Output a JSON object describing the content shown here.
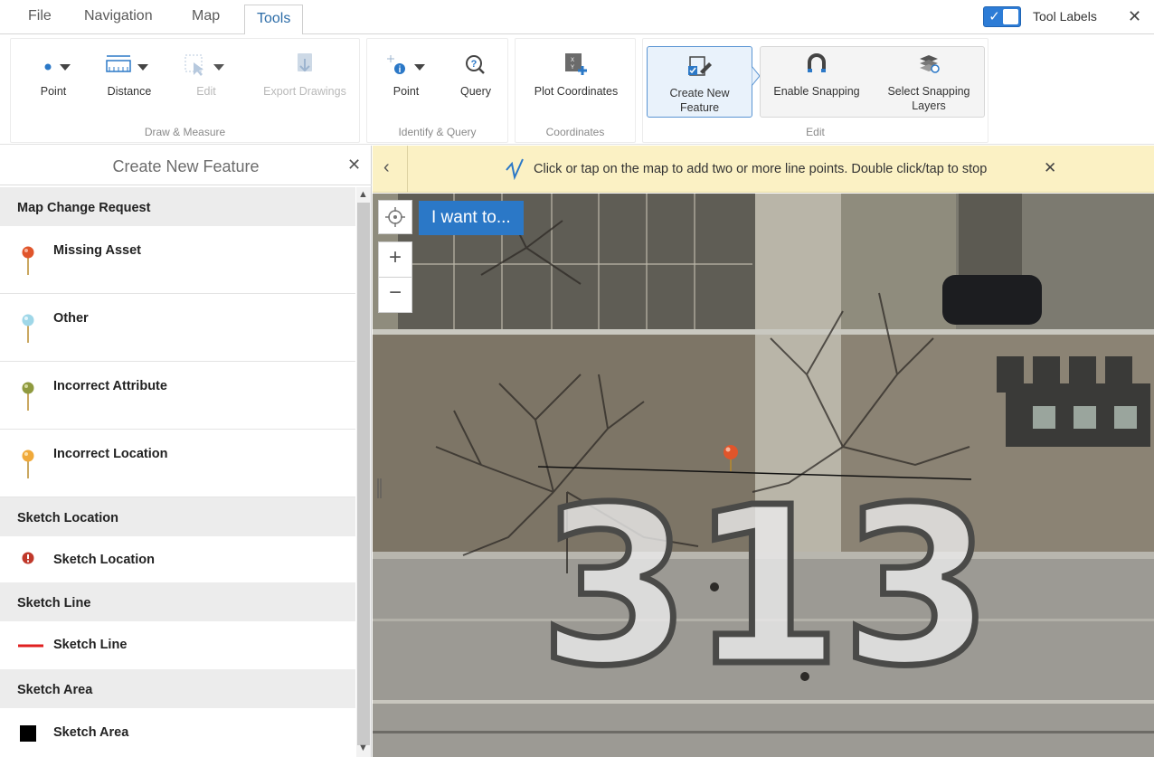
{
  "menu": {
    "tabs": [
      {
        "label": "File"
      },
      {
        "label": "Navigation"
      },
      {
        "label": "Map"
      },
      {
        "label": "Tools"
      }
    ],
    "active_tab": "Tools",
    "tool_labels_toggle": {
      "label": "Tool Labels",
      "checked": true
    }
  },
  "ribbon": {
    "groups": {
      "draw_measure": {
        "label": "Draw & Measure",
        "tools": {
          "point": "Point",
          "distance": "Distance",
          "edit": "Edit",
          "export": "Export Drawings"
        }
      },
      "identify_query": {
        "label": "Identify & Query",
        "tools": {
          "point": "Point",
          "query": "Query"
        }
      },
      "coordinates": {
        "label": "Coordinates",
        "tools": {
          "plot": "Plot Coordinates"
        }
      },
      "edit": {
        "label": "Edit",
        "tools": {
          "create_line1": "Create New",
          "create_line2": "Feature",
          "snapping": "Enable Snapping",
          "select_line1": "Select Snapping",
          "select_line2": "Layers"
        }
      }
    }
  },
  "panel": {
    "title": "Create New Feature",
    "sections": {
      "map_change": {
        "label": "Map Change Request",
        "items": [
          {
            "label": "Missing Asset",
            "color": "#e0552b"
          },
          {
            "label": "Other",
            "color": "#9fd7e8"
          },
          {
            "label": "Incorrect Attribute",
            "color": "#8f9a3f"
          },
          {
            "label": "Incorrect Location",
            "color": "#f0a93a"
          }
        ]
      },
      "sketch_location": {
        "label": "Sketch Location",
        "item": "Sketch Location",
        "color": "#c0392b"
      },
      "sketch_line": {
        "label": "Sketch Line",
        "item": "Sketch Line",
        "color": "#e02020"
      },
      "sketch_area": {
        "label": "Sketch Area",
        "item": "Sketch Area",
        "color": "#000000"
      }
    }
  },
  "notice": {
    "text": "Click or tap on the map to add two or more line points. Double click/tap to stop"
  },
  "map": {
    "i_want_to": "I want to...",
    "address_number": "313"
  },
  "colors": {
    "accent": "#2b78c7",
    "notice_bg": "#fbf1c4"
  }
}
